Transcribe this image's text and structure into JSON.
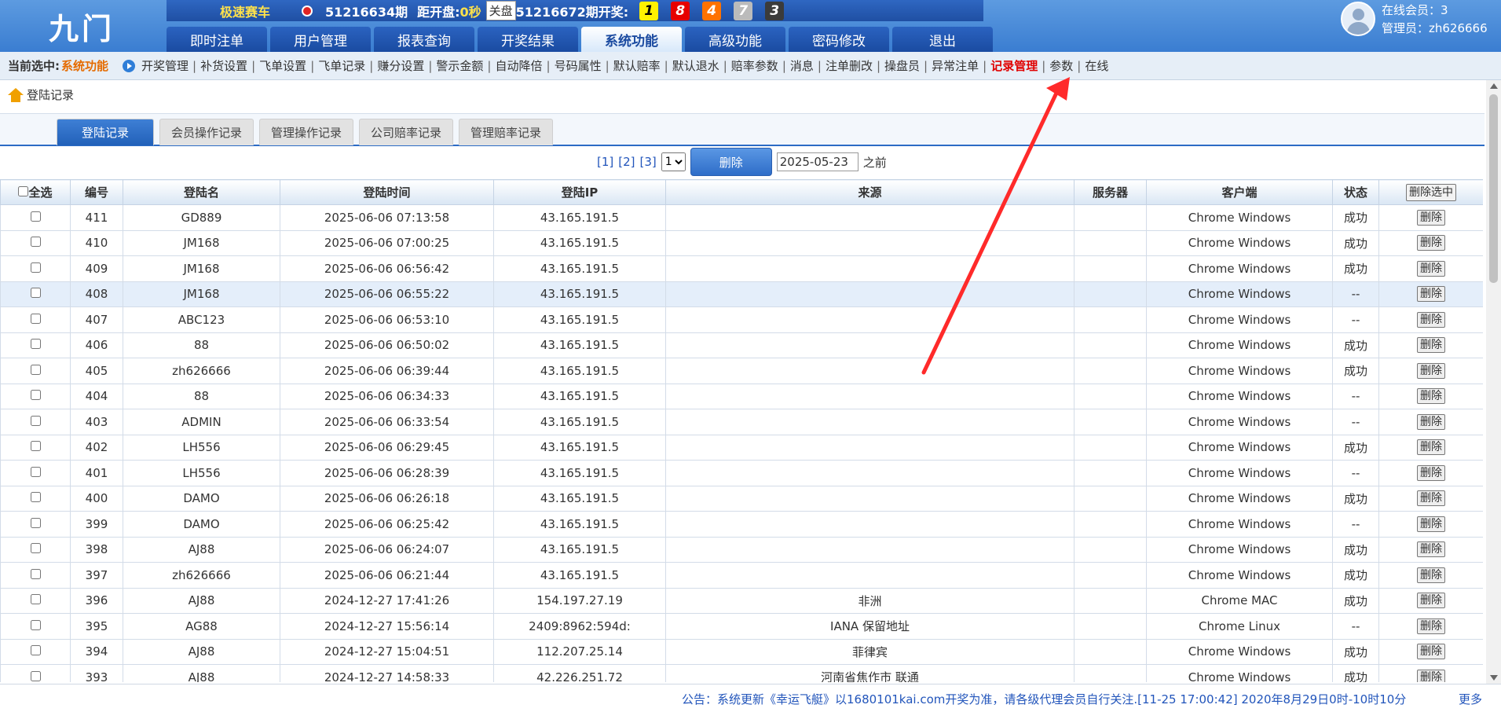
{
  "header": {
    "logo": "九门",
    "game_name": "极速赛车",
    "period": "51216634期",
    "dist_label": "距开盘:",
    "dist_value": "0秒",
    "close_label": "关盘",
    "next_period": "51216672期开奖:",
    "balls": [
      "1",
      "8",
      "4",
      "7",
      "3"
    ],
    "nav": [
      "即时注单",
      "用户管理",
      "报表查询",
      "开奖结果",
      "系统功能",
      "高级功能",
      "密码修改",
      "退出"
    ],
    "nav_active": "系统功能",
    "online": "在线会员：3",
    "admin": "管理员：zh626666"
  },
  "submenu": {
    "current_label": "当前选中:",
    "current_value": "系统功能",
    "items": [
      "开奖管理",
      "补货设置",
      "飞单设置",
      "飞单记录",
      "赚分设置",
      "警示金额",
      "自动降倍",
      "号码属性",
      "默认赔率",
      "默认退水",
      "赔率参数",
      "消息",
      "注单删改",
      "操盘员",
      "异常注单",
      "记录管理",
      "参数",
      "在线"
    ],
    "active": "记录管理"
  },
  "page_title": "登陆记录",
  "tabs": [
    "登陆记录",
    "会员操作记录",
    "管理操作记录",
    "公司赔率记录",
    "管理赔率记录"
  ],
  "tab_active": "登陆记录",
  "pager": {
    "pages": [
      "[1]",
      "[2]",
      "[3]"
    ],
    "select_value": "1",
    "delete_label": "删除",
    "date_value": "2025-05-23",
    "before_label": "之前"
  },
  "table": {
    "headers": [
      "全选",
      "编号",
      "登陆名",
      "登陆时间",
      "登陆IP",
      "来源",
      "服务器",
      "客户端",
      "状态",
      "删除选中"
    ],
    "delete_label": "删除",
    "rows": [
      [
        "411",
        "GD889",
        "2025-06-06 07:13:58",
        "43.165.191.5",
        "",
        "",
        "Chrome Windows",
        "成功"
      ],
      [
        "410",
        "JM168",
        "2025-06-06 07:00:25",
        "43.165.191.5",
        "",
        "",
        "Chrome Windows",
        "成功"
      ],
      [
        "409",
        "JM168",
        "2025-06-06 06:56:42",
        "43.165.191.5",
        "",
        "",
        "Chrome Windows",
        "成功"
      ],
      [
        "408",
        "JM168",
        "2025-06-06 06:55:22",
        "43.165.191.5",
        "",
        "",
        "Chrome Windows",
        "--"
      ],
      [
        "407",
        "ABC123",
        "2025-06-06 06:53:10",
        "43.165.191.5",
        "",
        "",
        "Chrome Windows",
        "--"
      ],
      [
        "406",
        "88",
        "2025-06-06 06:50:02",
        "43.165.191.5",
        "",
        "",
        "Chrome Windows",
        "成功"
      ],
      [
        "405",
        "zh626666",
        "2025-06-06 06:39:44",
        "43.165.191.5",
        "",
        "",
        "Chrome Windows",
        "成功"
      ],
      [
        "404",
        "88",
        "2025-06-06 06:34:33",
        "43.165.191.5",
        "",
        "",
        "Chrome Windows",
        "--"
      ],
      [
        "403",
        "ADMIN",
        "2025-06-06 06:33:54",
        "43.165.191.5",
        "",
        "",
        "Chrome Windows",
        "--"
      ],
      [
        "402",
        "LH556",
        "2025-06-06 06:29:45",
        "43.165.191.5",
        "",
        "",
        "Chrome Windows",
        "成功"
      ],
      [
        "401",
        "LH556",
        "2025-06-06 06:28:39",
        "43.165.191.5",
        "",
        "",
        "Chrome Windows",
        "--"
      ],
      [
        "400",
        "DAMO",
        "2025-06-06 06:26:18",
        "43.165.191.5",
        "",
        "",
        "Chrome Windows",
        "成功"
      ],
      [
        "399",
        "DAMO",
        "2025-06-06 06:25:42",
        "43.165.191.5",
        "",
        "",
        "Chrome Windows",
        "--"
      ],
      [
        "398",
        "AJ88",
        "2025-06-06 06:24:07",
        "43.165.191.5",
        "",
        "",
        "Chrome Windows",
        "成功"
      ],
      [
        "397",
        "zh626666",
        "2025-06-06 06:21:44",
        "43.165.191.5",
        "",
        "",
        "Chrome Windows",
        "成功"
      ],
      [
        "396",
        "AJ88",
        "2024-12-27 17:41:26",
        "154.197.27.19",
        "非洲",
        "",
        "Chrome MAC",
        "成功"
      ],
      [
        "395",
        "AG88",
        "2024-12-27 15:56:14",
        "2409:8962:594d:",
        "IANA 保留地址",
        "",
        "Chrome Linux",
        "--"
      ],
      [
        "394",
        "AJ88",
        "2024-12-27 15:04:51",
        "112.207.25.14",
        "菲律宾",
        "",
        "Chrome Windows",
        "成功"
      ],
      [
        "393",
        "AJ88",
        "2024-12-27 14:58:33",
        "42.226.251.72",
        "河南省焦作市 联通",
        "",
        "Chrome Windows",
        "成功"
      ]
    ],
    "highlight_row": 3
  },
  "footer": {
    "notice": "公告：系统更新《幸运飞艇》以1680101kai.com开奖为准，请各级代理会员自行关注.[11-25 17:00:42] 2020年8月29日0时-10时10分",
    "more": "更多"
  },
  "colors": {
    "header_blue": "#3a7dd1",
    "accent_orange": "#e56b00",
    "active_red": "#e00000",
    "arrow_red": "#ff2a2a"
  }
}
